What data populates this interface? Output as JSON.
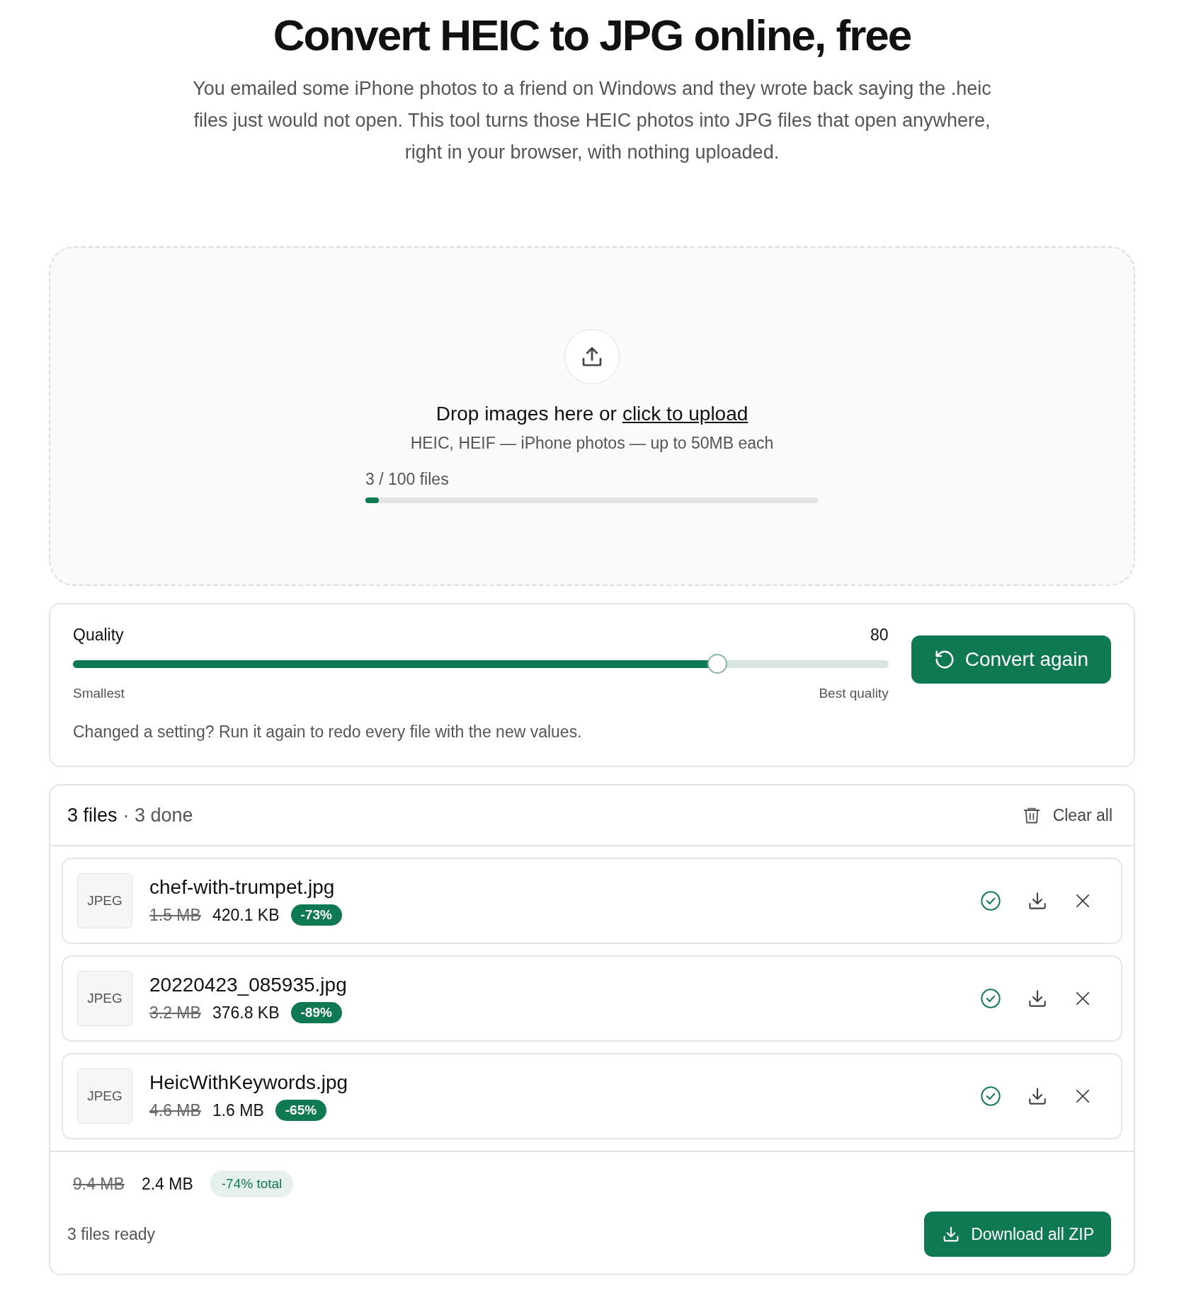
{
  "title": "Convert HEIC to JPG online, free",
  "intro": "You emailed some iPhone photos to a friend on Windows and they wrote back saying the .heic files just would not open. This tool turns those HEIC photos into JPG files that open anywhere, right in your browser, with nothing uploaded.",
  "upload": {
    "prompt": "Drop images here or",
    "link": "click to upload",
    "formats": "HEIC, HEIF — iPhone photos — up to 50MB each",
    "count": "3 / 100 files",
    "level": 0.03
  },
  "quality": {
    "label": "Quality",
    "value": "80",
    "level": 0.79,
    "min_label": "Smallest",
    "max_label": "Best quality",
    "note": "Changed a setting? Run it again to redo every file with the new values.",
    "button": "Convert again"
  },
  "files": {
    "count": "3 files",
    "done": "· 3 done",
    "clear": "Clear all",
    "items": [
      {
        "badge": "JPEG",
        "name": "chef-with-trumpet.jpg",
        "old_size": "1.5 MB",
        "new_size": "420.1 KB",
        "saving": "-73%",
        "done": true
      },
      {
        "badge": "JPEG",
        "name": "20220423_085935.jpg",
        "old_size": "3.2 MB",
        "new_size": "376.8 KB",
        "saving": "-89%",
        "done": true
      },
      {
        "badge": "JPEG",
        "name": "HeicWithKeywords.jpg",
        "old_size": "4.6 MB",
        "new_size": "1.6 MB",
        "saving": "-65%",
        "done": true
      }
    ]
  },
  "summary": {
    "old_total": "9.4 MB",
    "new_total": "2.4 MB",
    "saving": "-74% total"
  },
  "footer": {
    "ready": "3 files ready",
    "button": "Download all ZIP"
  }
}
